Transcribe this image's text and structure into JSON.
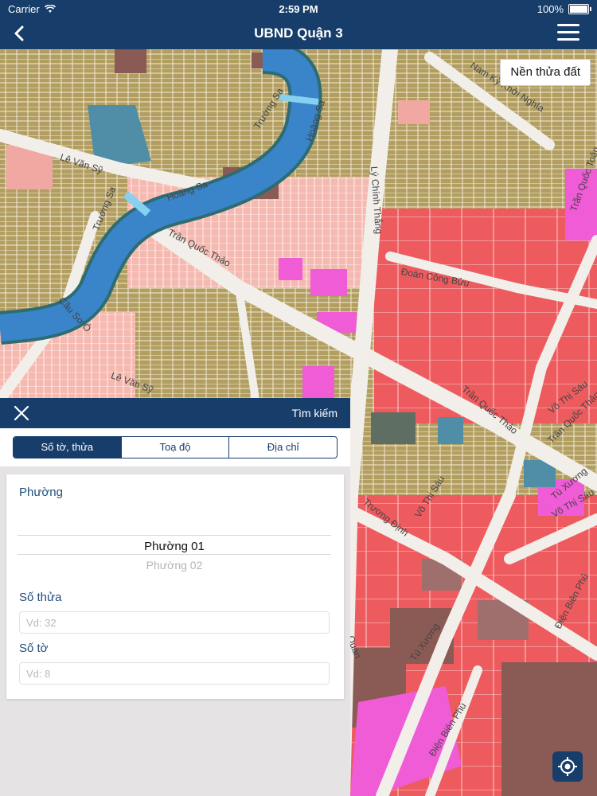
{
  "status_bar": {
    "carrier": "Carrier",
    "time": "2:59 PM",
    "battery": "100%",
    "battery_level": 1.0
  },
  "nav": {
    "title": "UBND Quận 3",
    "back_icon": "chevron-left-icon",
    "menu_icon": "hamburger-menu-icon"
  },
  "map": {
    "layer_button": "Nền thửa đất",
    "locate_icon": "locate-icon",
    "streets": {
      "le_van_sy": "Lê Văn Sỹ",
      "truong_sa_1": "Trường Sa",
      "truong_sa_2": "Trường Sa",
      "hoang_sa_1": "Hoàng Sa",
      "hoang_sa_2": "Hoàng Sa",
      "ly_chinh_thang": "Lý Chính Thắng",
      "nam_ky_khoi_nghia": "Nam Kỳ Khởi Nghĩa",
      "tran_quoc_than": "Trần Quốc Thảo",
      "doan_cong_buu": "Đoàn Công Bửu",
      "tran_quoc_thao_2": "Trần Quốc Thảo",
      "tran_quoc_thao_3": "Trần Quốc Thảo",
      "vo_thi_sau_1": "Võ Thị Sáu",
      "vo_thi_sau_2": "Võ Thị Sáu",
      "vo_thi_sau_3": "Võ Thị Sáu",
      "truong_dinh": "Trương Định",
      "tu_xuong_1": "Tú Xương",
      "tu_xuong_2": "Tú Xương",
      "dien_bien_phu_1": "Điện Biên Phủ",
      "dien_bien_phu_2": "Điện Biên Phủ",
      "cau_so_o": "Cầu Sơ Ó",
      "tran_quoc_toan": "Trần Quốc Toản",
      "le_van_sy_2": "Lê Văn Sỹ",
      "quan": "Quan"
    }
  },
  "search_panel": {
    "title": "Tìm kiếm",
    "close_icon": "close-icon",
    "tabs": [
      {
        "label": "Số tờ, thửa",
        "active": true
      },
      {
        "label": "Toạ độ",
        "active": false
      },
      {
        "label": "Địa chỉ",
        "active": false
      }
    ],
    "ward": {
      "label": "Phường",
      "selected": "Phường 01",
      "next": "Phường 02"
    },
    "parcel_no": {
      "label": "Số thửa",
      "placeholder": "Vd: 32",
      "value": ""
    },
    "sheet_no": {
      "label": "Số tờ",
      "placeholder": "Vd: 8",
      "value": ""
    }
  },
  "colors": {
    "nav_bg": "#173e6b",
    "river": "#3a84c9",
    "road": "#f2efea",
    "olive_parcel": "#b29e60",
    "pink_parcel": "#f1a8a2",
    "red_parcel": "#ee5b5e",
    "magenta_parcel": "#f05bd6",
    "brown_parcel": "#8a5a55",
    "teal_parcel": "#4f8ea6"
  }
}
